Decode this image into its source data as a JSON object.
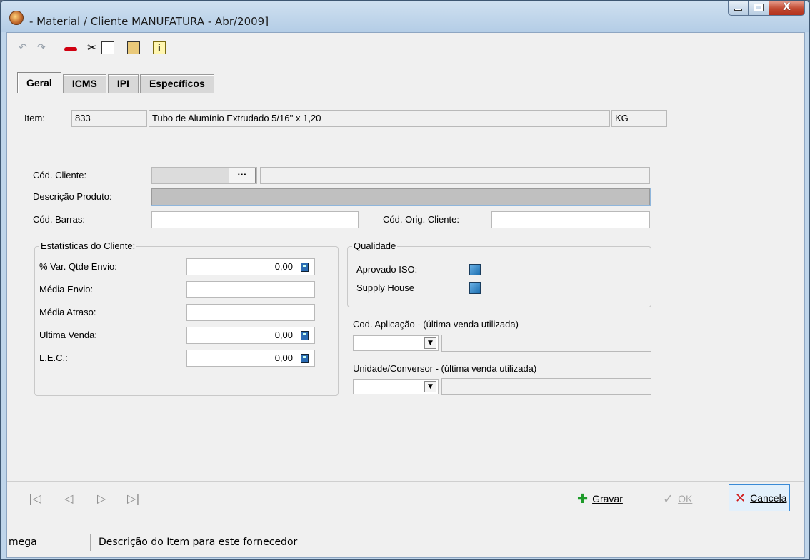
{
  "window": {
    "title": "- Material / Cliente MANUFATURA - Abr/2009]",
    "controls": {
      "minimize": "–",
      "maximize": "□",
      "close": "X"
    }
  },
  "toolbar": {
    "icons": [
      "undo-icon",
      "redo-icon",
      "stop-icon",
      "cut-icon",
      "copy-icon",
      "paste-icon",
      "info-icon"
    ],
    "undo_glyph": "↶",
    "redo_glyph": "↷",
    "cut_glyph": "✂"
  },
  "tabs": [
    {
      "label": "Geral",
      "active": true
    },
    {
      "label": "ICMS",
      "active": false
    },
    {
      "label": "IPI",
      "active": false
    },
    {
      "label": "Específicos",
      "active": false
    }
  ],
  "item": {
    "label": "Item:",
    "code": "833",
    "description": "Tubo de Alumínio Extrudado 5/16'' x 1,20",
    "unit": "KG"
  },
  "form": {
    "cod_cliente_label": "Cód. Cliente:",
    "ellipsis": "···",
    "descricao_produto_label": "Descrição Produto:",
    "cod_barras_label": "Cód. Barras:",
    "cod_orig_cliente_label": "Cód. Orig. Cliente:"
  },
  "estatisticas": {
    "title": "Estatísticas do Cliente:",
    "var_qtde_label": "% Var. Qtde Envio:",
    "var_qtde_value": "0,00",
    "media_envio_label": "Média Envio:",
    "media_atraso_label": "Média Atraso:",
    "ultima_venda_label": "Ultima Venda:",
    "ultima_venda_value": "0,00",
    "lec_label": "L.E.C.:",
    "lec_value": "0,00"
  },
  "qualidade": {
    "title": "Qualidade",
    "aprovado_iso_label": "Aprovado ISO:",
    "supply_house_label": "Supply House"
  },
  "aplicacao": {
    "cod_aplicacao_label": "Cod. Aplicação - (última venda utilizada)",
    "unidade_label": "Unidade/Conversor - (última venda utilizada)",
    "dropdown_glyph": "▼"
  },
  "nav": {
    "first": "|◁",
    "prev": "◁",
    "next": "▷",
    "last": "▷|"
  },
  "actions": {
    "gravar": "Gravar",
    "ok": "OK",
    "cancela": "Cancela",
    "gravar_icon": "✚",
    "ok_icon": "✓",
    "cancel_icon": "✕"
  },
  "status": {
    "user": "mega",
    "message": "Descrição do Item para este fornecedor"
  },
  "colors": {
    "accent": "#3a8ad6",
    "gravar_green": "#1e9b2a",
    "cancel_red": "#d01818"
  }
}
